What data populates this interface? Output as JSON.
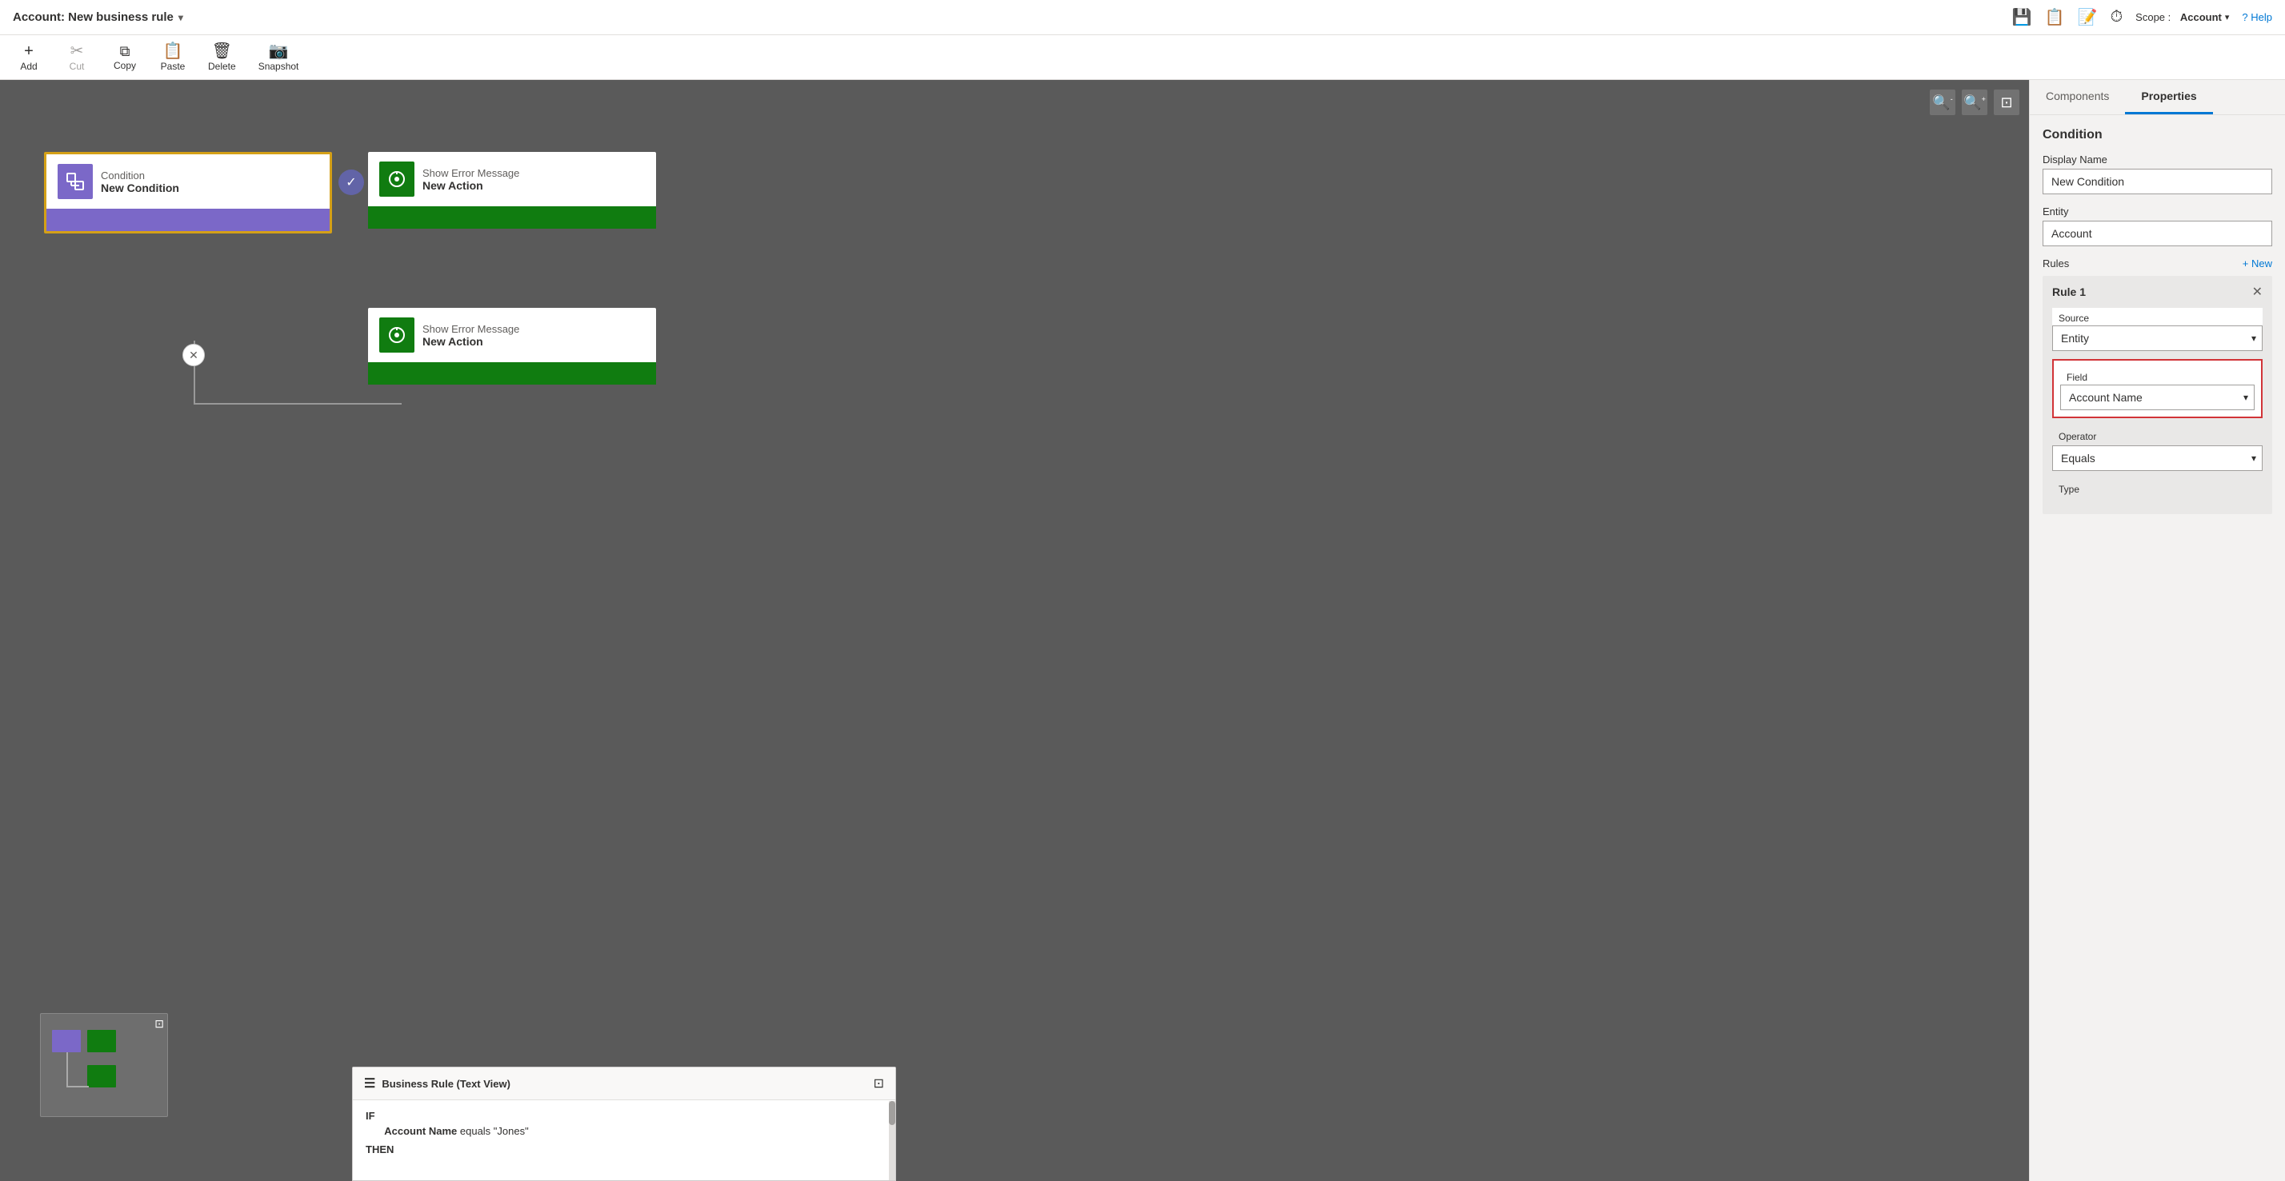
{
  "titleBar": {
    "title": "Account: New business rule",
    "chevron": "▾",
    "actions": [
      {
        "name": "save-icon",
        "icon": "💾",
        "label": ""
      },
      {
        "name": "rules-icon",
        "icon": "📋",
        "label": ""
      },
      {
        "name": "check-icon",
        "icon": "✅",
        "label": ""
      },
      {
        "name": "history-icon",
        "icon": "⏱",
        "label": ""
      }
    ],
    "scopeLabel": "Scope :",
    "scopeValue": "Account",
    "helpLabel": "? Help"
  },
  "toolbar": {
    "buttons": [
      {
        "name": "add-button",
        "icon": "+",
        "label": "Add",
        "disabled": false
      },
      {
        "name": "cut-button",
        "icon": "✂",
        "label": "Cut",
        "disabled": true
      },
      {
        "name": "copy-button",
        "icon": "⧉",
        "label": "Copy",
        "disabled": false
      },
      {
        "name": "paste-button",
        "icon": "📋",
        "label": "Paste",
        "disabled": false
      },
      {
        "name": "delete-button",
        "icon": "🗑",
        "label": "Delete",
        "disabled": false
      },
      {
        "name": "snapshot-button",
        "icon": "📷",
        "label": "Snapshot",
        "disabled": false
      }
    ]
  },
  "canvas": {
    "conditionNode": {
      "iconLabel": "⚙",
      "typeLabel": "Condition",
      "nameLabel": "New Condition"
    },
    "actionNode1": {
      "typeLabel": "Show Error Message",
      "nameLabel": "New Action"
    },
    "actionNode2": {
      "typeLabel": "Show Error Message",
      "nameLabel": "New Action"
    }
  },
  "businessRuleTextView": {
    "title": "Business Rule (Text View)",
    "ifLabel": "IF",
    "conditionLine": "Account Name equals \"Jones\"",
    "thenLabel": "THEN"
  },
  "rightPanel": {
    "tabs": [
      {
        "label": "Components",
        "active": false
      },
      {
        "label": "Properties",
        "active": true
      }
    ],
    "sectionTitle": "Condition",
    "displayNameLabel": "Display Name",
    "displayNameValue": "New Condition",
    "entityLabel": "Entity",
    "entityValue": "Account",
    "rulesLabel": "Rules",
    "rulesNewLabel": "+ New",
    "rule": {
      "name": "Rule 1",
      "sourceLabel": "Source",
      "sourceValue": "Entity",
      "fieldLabel": "Field",
      "fieldValue": "Account Name",
      "operatorLabel": "Operator",
      "operatorValue": "Equals",
      "typeLabel": "Type"
    }
  }
}
